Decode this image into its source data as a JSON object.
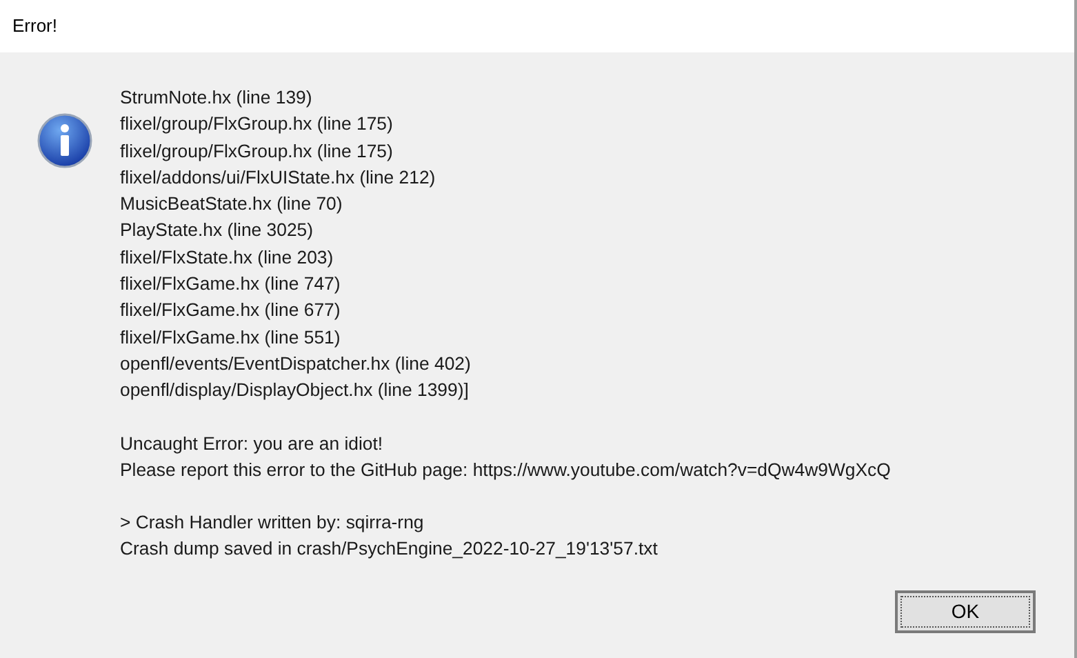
{
  "window": {
    "title": "Error!"
  },
  "message_groups": [
    [
      "StrumNote.hx (line 139)",
      "flixel/group/FlxGroup.hx (line 175)",
      "flixel/group/FlxGroup.hx (line 175)",
      "flixel/addons/ui/FlxUIState.hx (line 212)",
      "MusicBeatState.hx (line 70)",
      "PlayState.hx (line 3025)",
      "flixel/FlxState.hx (line 203)",
      "flixel/FlxGame.hx (line 747)",
      "flixel/FlxGame.hx (line 677)",
      "flixel/FlxGame.hx (line 551)",
      "openfl/events/EventDispatcher.hx (line 402)",
      "openfl/display/DisplayObject.hx (line 1399)]"
    ],
    [
      "Uncaught Error: you are an idiot!",
      "Please report this error to the GitHub page: https://www.youtube.com/watch?v=dQw4w9WgXcQ"
    ],
    [
      "> Crash Handler written by: sqirra-rng",
      "Crash dump saved in crash/PsychEngine_2022-10-27_19'13'57.txt"
    ]
  ],
  "buttons": [
    {
      "label": "OK",
      "focused": true
    }
  ]
}
